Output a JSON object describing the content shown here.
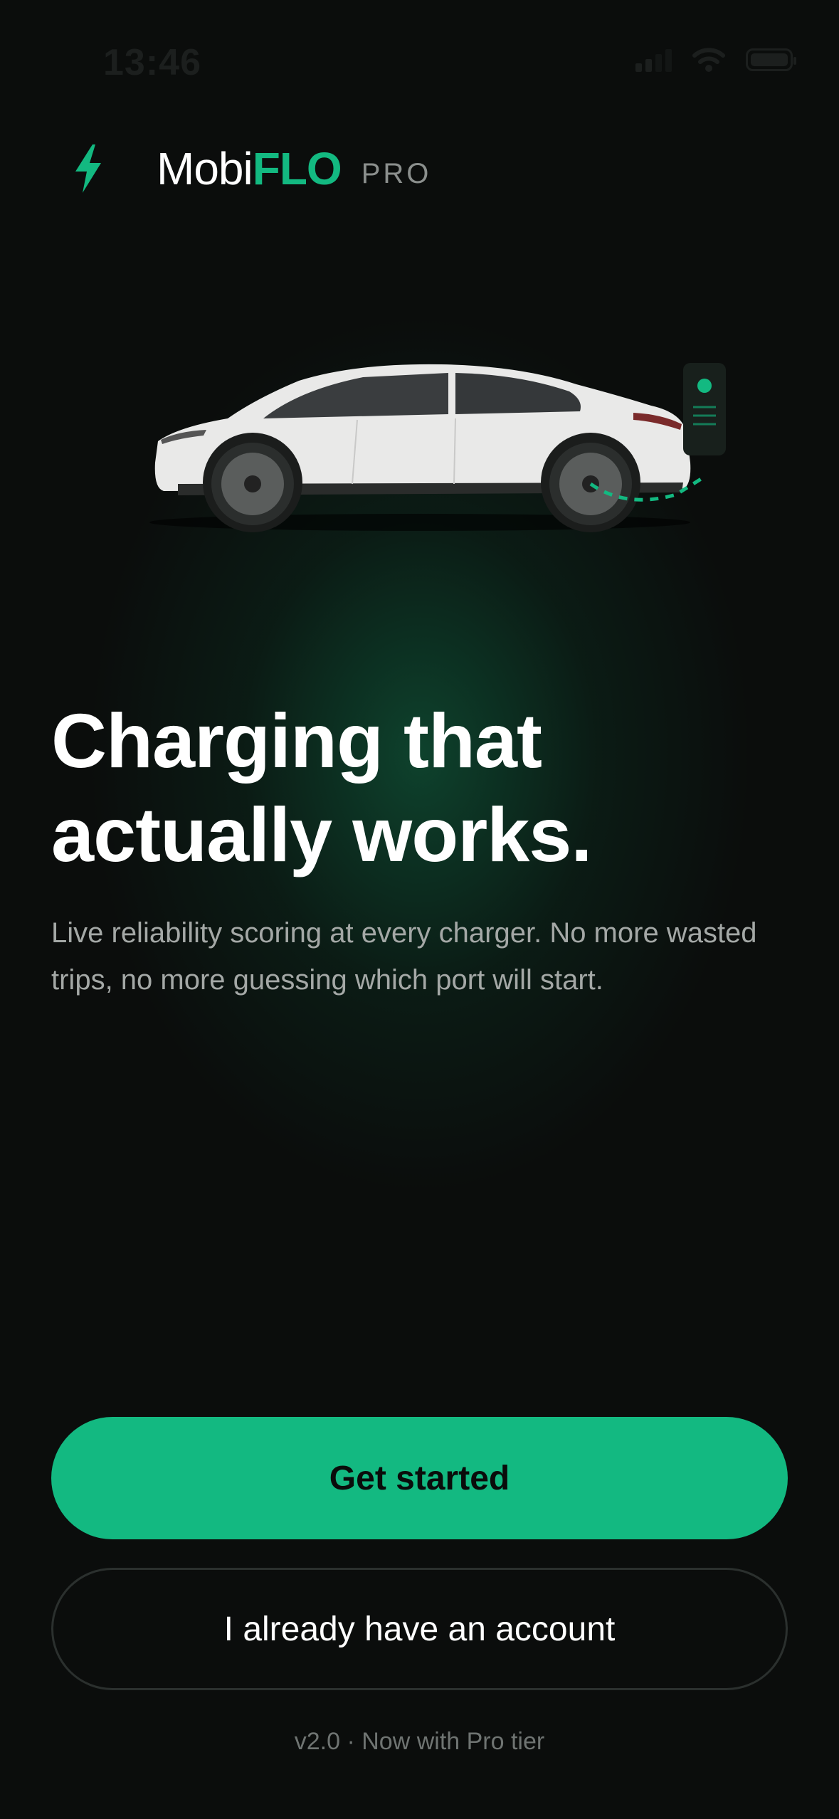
{
  "status_bar": {
    "time": "13:46"
  },
  "brand": {
    "name_plain": "Mobi",
    "name_accent": "FLO",
    "tier": "PRO",
    "accent_color": "#13b981"
  },
  "hero": {
    "headline_line1": "Charging that",
    "headline_line2": "actually works.",
    "subtitle": "Live reliability scoring at every charger. No more wasted trips, no more guessing which port will start."
  },
  "actions": {
    "primary_label": "Get started",
    "secondary_label": "I already have an account"
  },
  "footer": {
    "version_text": "v2.0 · Now with Pro tier"
  },
  "icons": [
    "bolt-icon",
    "signal-icon",
    "wifi-icon",
    "battery-icon",
    "car-illustration",
    "charger-icon"
  ]
}
